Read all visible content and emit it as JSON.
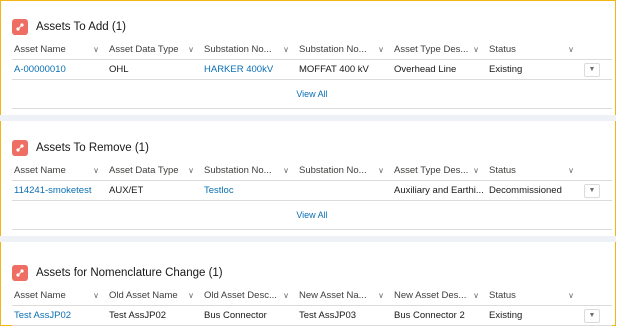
{
  "cards": [
    {
      "title": "Assets To Add (1)",
      "columns": [
        "Asset Name",
        "Asset Data Type",
        "Substation No...",
        "Substation No...",
        "Asset Type Des...",
        "Status"
      ],
      "row": [
        "A-00000010",
        "OHL",
        "HARKER 400kV",
        "MOFFAT 400 kV",
        "Overhead Line",
        "Existing"
      ],
      "view_all": "View All"
    },
    {
      "title": "Assets To Remove (1)",
      "columns": [
        "Asset Name",
        "Asset Data Type",
        "Substation No...",
        "Substation No...",
        "Asset Type Des...",
        "Status"
      ],
      "row": [
        "114241-smoketest",
        "AUX/ET",
        "Testloc",
        "",
        "Auxiliary and Earthi...",
        "Decommissioned"
      ],
      "view_all": "View All"
    },
    {
      "title": "Assets for Nomenclature Change (1)",
      "columns": [
        "Asset Name",
        "Old Asset Name",
        "Old Asset Desc...",
        "New Asset Na...",
        "New Asset Des...",
        "Status"
      ],
      "row": [
        "Test AssJP02",
        "Test AssJP02",
        "Bus Connector",
        "Test AssJP03",
        "Bus Connector 2",
        "Existing"
      ]
    }
  ],
  "icons": {
    "card_icon": "asset-hierarchy-icon",
    "sort": "chevron-down-icon",
    "row_menu": "dropdown-arrow-icon"
  },
  "colors": {
    "link": "#0b6fb3",
    "icon_bg": "#ef6e64",
    "frame": "#f2b514"
  }
}
